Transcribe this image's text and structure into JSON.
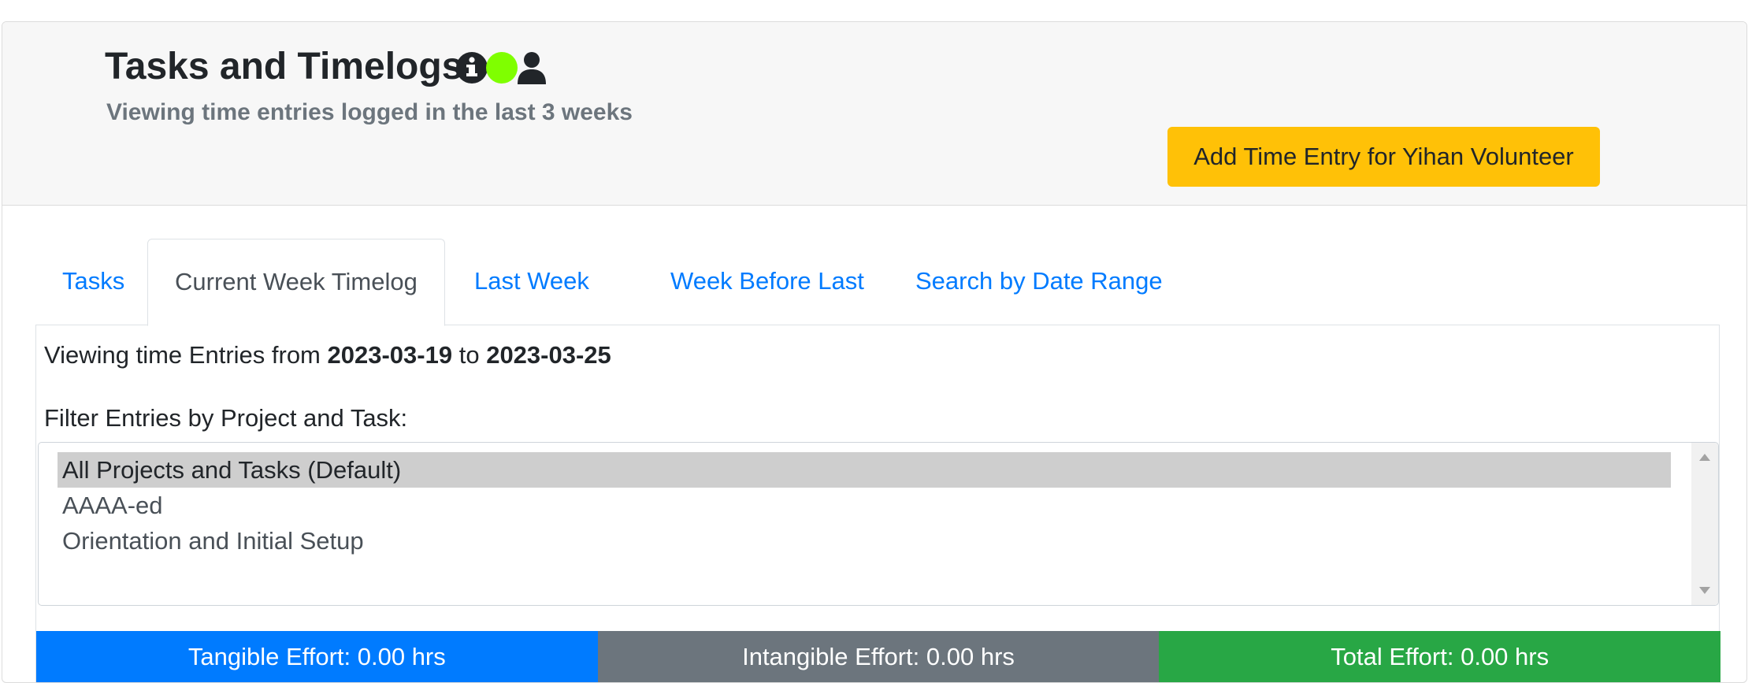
{
  "header": {
    "title": "Tasks and Timelogs",
    "subtitle": "Viewing time entries logged in the last 3 weeks",
    "icons": [
      "info-circle-icon",
      "status-dot-icon",
      "user-icon"
    ],
    "status_dot_color": "#7fff00",
    "add_button_label": "Add Time Entry for Yihan Volunteer",
    "add_button_color": "#ffc107"
  },
  "tabs": [
    {
      "label": "Tasks",
      "active": false
    },
    {
      "label": "Current Week Timelog",
      "active": true
    },
    {
      "label": "Last Week",
      "active": false
    },
    {
      "label": "Week Before Last",
      "active": false
    },
    {
      "label": "Search by Date Range",
      "active": false
    }
  ],
  "timelog": {
    "viewing_prefix": "Viewing time Entries from",
    "start_date": "2023-03-19",
    "connector": "to",
    "end_date": "2023-03-25",
    "filter_label": "Filter Entries by Project and Task:",
    "options": [
      {
        "label": "All Projects and Tasks (Default)",
        "selected": true
      },
      {
        "label": "AAAA-ed",
        "selected": false
      },
      {
        "label": "Orientation and Initial Setup",
        "selected": false
      }
    ]
  },
  "effort": {
    "tangible": "Tangible Effort: 0.00 hrs",
    "intangible": "Intangible Effort: 0.00 hrs",
    "total": "Total Effort: 0.00 hrs",
    "colors": {
      "tangible": "#007bff",
      "intangible": "#6c757d",
      "total": "#28a745"
    }
  }
}
